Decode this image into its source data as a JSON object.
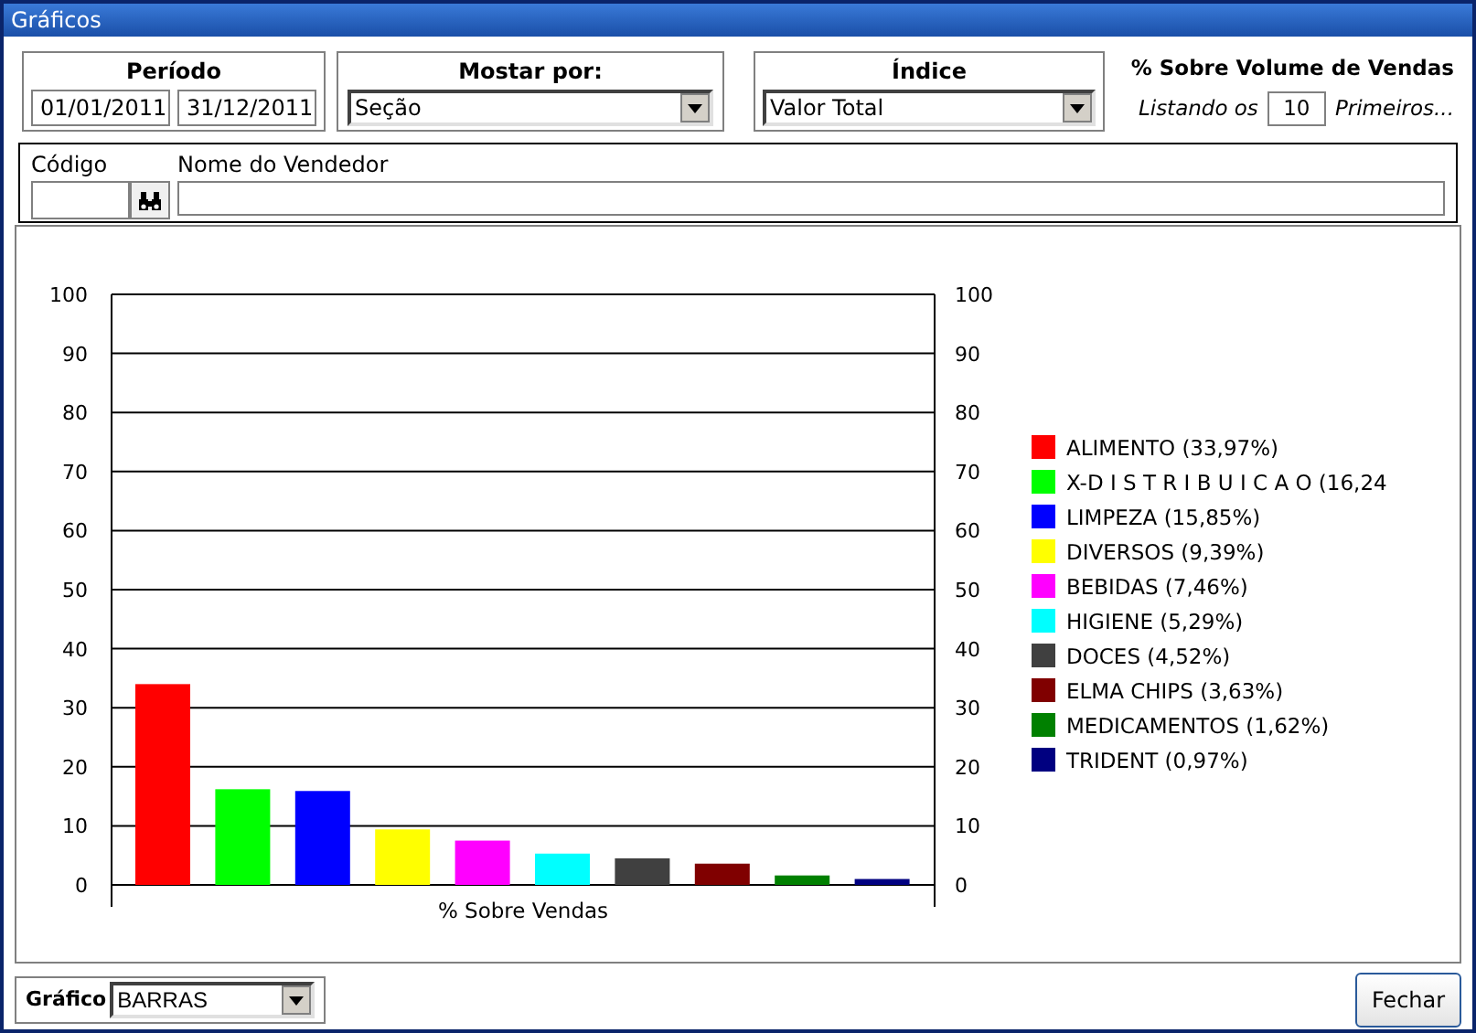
{
  "window": {
    "title": "Gráficos"
  },
  "periodo": {
    "label": "Período",
    "start": "01/01/2011",
    "end": "31/12/2011"
  },
  "mostrar_por": {
    "label": "Mostar por:",
    "value": "Seção"
  },
  "indice": {
    "label": "Índice",
    "value": "Valor Total"
  },
  "volume": {
    "title": "% Sobre Volume de Vendas",
    "prefix": "Listando os",
    "count": "10",
    "suffix": "Primeiros..."
  },
  "vendedor": {
    "codigo_label": "Código",
    "nome_label": "Nome do Vendedor"
  },
  "chart": {
    "chart_data": {
      "type": "bar",
      "categories": [
        "% Sobre Vendas"
      ],
      "ylim": [
        0,
        100
      ],
      "yticks": [
        0,
        10,
        20,
        30,
        40,
        50,
        60,
        70,
        80,
        90,
        100
      ],
      "grid": true,
      "legend": true,
      "series": [
        {
          "name": "ALIMENTO (33,97%)",
          "color": "#ff0000",
          "values": [
            34.0
          ]
        },
        {
          "name": "X-D I S T R I B U I C A O (16,24",
          "color": "#00ff00",
          "values": [
            16.2
          ]
        },
        {
          "name": "LIMPEZA (15,85%)",
          "color": "#0000ff",
          "values": [
            15.9
          ]
        },
        {
          "name": "DIVERSOS (9,39%)",
          "color": "#ffff00",
          "values": [
            9.4
          ]
        },
        {
          "name": "BEBIDAS (7,46%)",
          "color": "#ff00ff",
          "values": [
            7.5
          ]
        },
        {
          "name": "HIGIENE (5,29%)",
          "color": "#00ffff",
          "values": [
            5.3
          ]
        },
        {
          "name": "DOCES (4,52%)",
          "color": "#404040",
          "values": [
            4.5
          ]
        },
        {
          "name": "ELMA CHIPS (3,63%)",
          "color": "#800000",
          "values": [
            3.6
          ]
        },
        {
          "name": "MEDICAMENTOS (1,62%)",
          "color": "#008000",
          "values": [
            1.6
          ]
        },
        {
          "name": "TRIDENT (0,97%)",
          "color": "#000080",
          "values": [
            1.0
          ]
        }
      ]
    },
    "right_axis_labels": [
      "100",
      "90",
      "80",
      "70",
      "60",
      "50",
      "40",
      "30",
      "20",
      "10",
      "0"
    ]
  },
  "grafico": {
    "label": "Gráfico",
    "value": "BARRAS"
  },
  "close_button": "Fechar"
}
